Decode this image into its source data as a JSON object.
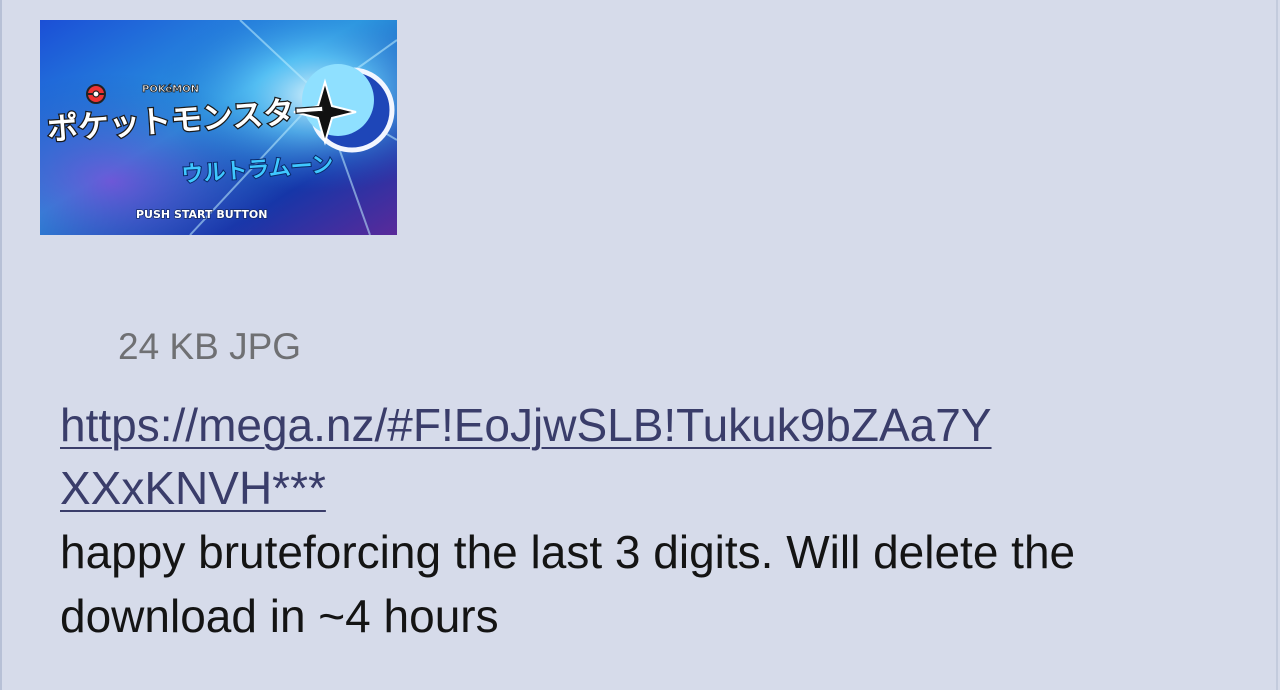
{
  "post": {
    "thumbnail": {
      "logo_small_text": "POKéMON",
      "logo_main_text": "ポケットモンスター",
      "logo_sub_text": "ウルトラムーン",
      "prompt_text": "PUSH START BUTTON"
    },
    "file_info": "24 KB JPG",
    "link_text": "https://mega.nz/#F!EoJjwSLB!Tukuk9bZAa7YXXxKNVH***",
    "comment_text": "happy bruteforcing the last 3 digits. Will delete the download in ~4 hours"
  },
  "colors": {
    "background": "#d6dbea",
    "link": "#3a3d6a",
    "meta_text": "#6f7073",
    "body_text": "#141414"
  }
}
